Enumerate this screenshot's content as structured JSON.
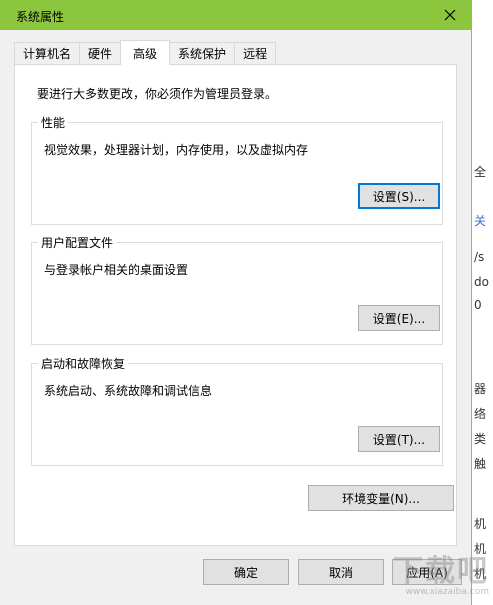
{
  "window": {
    "title": "系统属性"
  },
  "tabs": [
    {
      "label": "计算机名",
      "active": false
    },
    {
      "label": "硬件",
      "active": false
    },
    {
      "label": "高级",
      "active": true
    },
    {
      "label": "系统保护",
      "active": false
    },
    {
      "label": "远程",
      "active": false
    }
  ],
  "note": "要进行大多数更改，你必须作为管理员登录。",
  "performance": {
    "legend": "性能",
    "desc": "视觉效果，处理器计划，内存使用，以及虚拟内存",
    "button": "设置(S)..."
  },
  "profiles": {
    "legend": "用户配置文件",
    "desc": "与登录帐户相关的桌面设置",
    "button": "设置(E)..."
  },
  "startup": {
    "legend": "启动和故障恢复",
    "desc": "系统启动、系统故障和调试信息",
    "button": "设置(T)..."
  },
  "env_button": "环境变量(N)...",
  "footer": {
    "ok": "确定",
    "cancel": "取消",
    "apply": "应用(A)"
  },
  "watermark": {
    "big": "下载吧",
    "small": "www.xiazaiba.com"
  },
  "background_fragments": [
    "全",
    "关",
    "/s",
    "do",
    "0",
    "器",
    "络",
    "类",
    "触",
    "机",
    "机",
    "机"
  ],
  "colors": {
    "titlebar": "#8cc63f",
    "focus": "#0078d7"
  }
}
